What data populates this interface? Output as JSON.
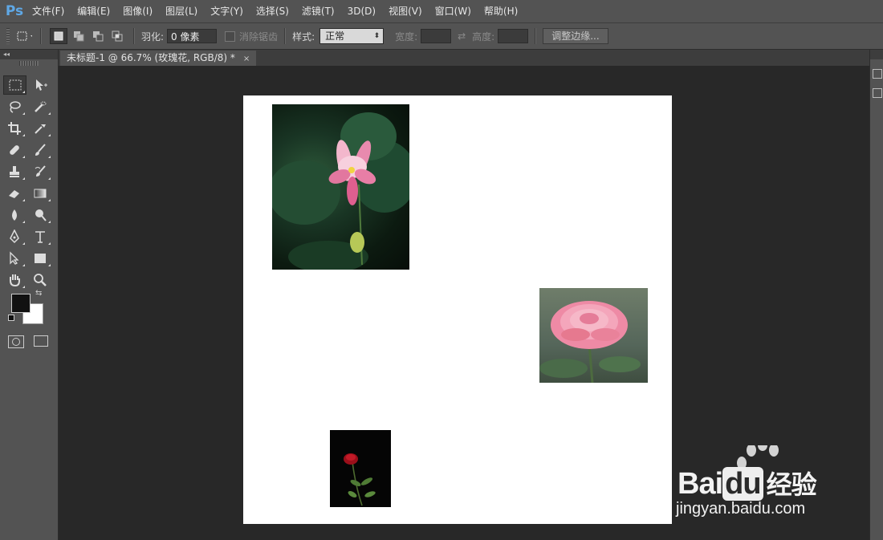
{
  "app": {
    "logo": "Ps"
  },
  "menu": [
    "文件(F)",
    "编辑(E)",
    "图像(I)",
    "图层(L)",
    "文字(Y)",
    "选择(S)",
    "滤镜(T)",
    "3D(D)",
    "视图(V)",
    "窗口(W)",
    "帮助(H)"
  ],
  "options": {
    "feather_label": "羽化:",
    "feather_value": "0 像素",
    "antialias_label": "消除锯齿",
    "style_label": "样式:",
    "style_value": "正常",
    "width_label": "宽度:",
    "height_label": "高度:",
    "refine_edge": "调整边缘..."
  },
  "document": {
    "tab_title": "未标题-1 @ 66.7% (玫瑰花, RGB/8) *",
    "close": "×"
  },
  "panel": {
    "collapse": "◂◂"
  },
  "colors": {
    "foreground": "#111111",
    "background": "#ffffff",
    "accent": "#5fa8e6"
  },
  "watermark": {
    "brand_a": "Bai",
    "brand_b": "du",
    "brand_cn": "经验",
    "url": "jingyan.baidu.com"
  },
  "icons": [
    "marquee-icon",
    "move-icon",
    "lasso-icon",
    "quick-select-icon",
    "crop-icon",
    "eyedropper-icon",
    "healing-icon",
    "brush-icon",
    "stamp-icon",
    "history-brush-icon",
    "eraser-icon",
    "gradient-icon",
    "blur-icon",
    "dodge-icon",
    "pen-icon",
    "type-icon",
    "path-select-icon",
    "rectangle-icon",
    "hand-icon",
    "zoom-icon",
    "quickmask-icon",
    "screenmode-icon"
  ]
}
